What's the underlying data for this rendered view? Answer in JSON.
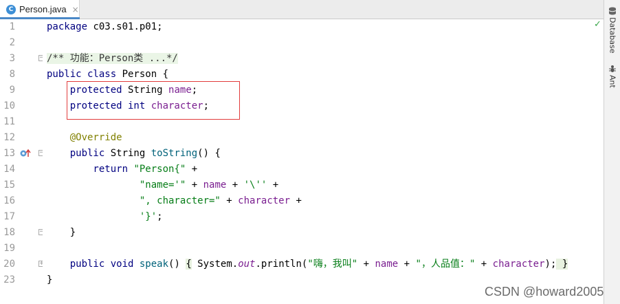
{
  "tab": {
    "icon": "c-class-icon",
    "icon_glyph": "C",
    "title": "Person.java",
    "close": "×"
  },
  "sidebar": [
    {
      "label": "Database",
      "icon": "database-icon"
    },
    {
      "label": "Ant",
      "icon": "ant-icon"
    }
  ],
  "gutter": {
    "line_numbers": [
      "1",
      "2",
      "3",
      "8",
      "9",
      "10",
      "11",
      "12",
      "13",
      "14",
      "15",
      "16",
      "17",
      "18",
      "19",
      "20",
      "23"
    ]
  },
  "code": [
    [
      {
        "t": "package ",
        "c": "kw"
      },
      {
        "t": "c03.s01.p01;",
        "c": "plain"
      }
    ],
    [],
    [
      {
        "t": "/** 功能：Person类 ...*/",
        "c": "cmt"
      }
    ],
    [
      {
        "t": "public class ",
        "c": "kw"
      },
      {
        "t": "Person {",
        "c": "plain"
      }
    ],
    [
      {
        "t": "    protected ",
        "c": "kw"
      },
      {
        "t": "String ",
        "c": "plain"
      },
      {
        "t": "name",
        "c": "fld"
      },
      {
        "t": ";",
        "c": "plain"
      }
    ],
    [
      {
        "t": "    protected int ",
        "c": "kw"
      },
      {
        "t": "character",
        "c": "fld"
      },
      {
        "t": ";",
        "c": "plain"
      }
    ],
    [],
    [
      {
        "t": "    @Override",
        "c": "ann"
      }
    ],
    [
      {
        "t": "    public ",
        "c": "kw"
      },
      {
        "t": "String ",
        "c": "plain"
      },
      {
        "t": "toString",
        "c": "mth"
      },
      {
        "t": "() {",
        "c": "plain"
      }
    ],
    [
      {
        "t": "        return ",
        "c": "kw"
      },
      {
        "t": "\"Person{\"",
        "c": "str"
      },
      {
        "t": " +",
        "c": "plain"
      }
    ],
    [
      {
        "t": "                ",
        "c": "plain"
      },
      {
        "t": "\"name='\"",
        "c": "str"
      },
      {
        "t": " + ",
        "c": "plain"
      },
      {
        "t": "name",
        "c": "fld"
      },
      {
        "t": " + ",
        "c": "plain"
      },
      {
        "t": "'\\''",
        "c": "str"
      },
      {
        "t": " +",
        "c": "plain"
      }
    ],
    [
      {
        "t": "                ",
        "c": "plain"
      },
      {
        "t": "\", character=\"",
        "c": "str"
      },
      {
        "t": " + ",
        "c": "plain"
      },
      {
        "t": "character",
        "c": "fld"
      },
      {
        "t": " +",
        "c": "plain"
      }
    ],
    [
      {
        "t": "                ",
        "c": "plain"
      },
      {
        "t": "'}'",
        "c": "str"
      },
      {
        "t": ";",
        "c": "plain"
      }
    ],
    [
      {
        "t": "    }",
        "c": "plain"
      }
    ],
    [],
    [
      {
        "t": "    public void ",
        "c": "kw"
      },
      {
        "t": "speak",
        "c": "mth"
      },
      {
        "t": "() ",
        "c": "plain"
      },
      {
        "t": "{",
        "c": "brace-hl"
      },
      {
        "t": " System.",
        "c": "plain"
      },
      {
        "t": "out",
        "c": "ital"
      },
      {
        "t": ".println(",
        "c": "plain"
      },
      {
        "t": "\"嗨，我叫\"",
        "c": "str"
      },
      {
        "t": " + ",
        "c": "plain"
      },
      {
        "t": "name",
        "c": "fld"
      },
      {
        "t": " + ",
        "c": "plain"
      },
      {
        "t": "\"，人品值：\"",
        "c": "str"
      },
      {
        "t": " + ",
        "c": "plain"
      },
      {
        "t": "character",
        "c": "fld"
      },
      {
        "t": ");",
        "c": "plain"
      },
      {
        "t": " }",
        "c": "brace-hl"
      }
    ],
    [
      {
        "t": "}",
        "c": "plain"
      }
    ]
  ],
  "status": {
    "check": "✓"
  },
  "watermark": "CSDN @howard2005",
  "colors": {
    "keyword": "#000080",
    "field": "#7a1e90",
    "string": "#067d17",
    "annotation": "#808000",
    "method": "#00627a",
    "highlight_box": "#e23b3b",
    "current_line": "#fcfae2"
  }
}
